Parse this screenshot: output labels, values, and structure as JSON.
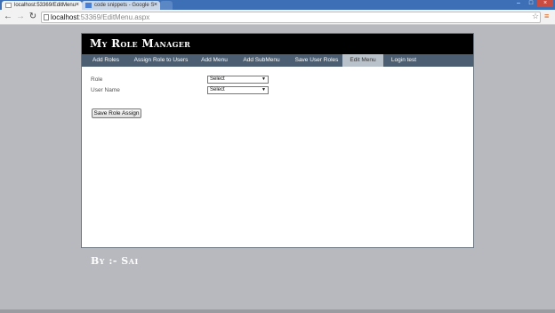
{
  "browser": {
    "tabs": [
      {
        "title": "localhost:53369/EditMenu",
        "active": true
      },
      {
        "title": "code snippets - Google S",
        "active": false
      }
    ],
    "url_host": "localhost",
    "url_path": ":53369/EditMenu.aspx",
    "close_glyph": "×",
    "window_controls": {
      "minimize": "–",
      "maximize": "□",
      "close": "×"
    }
  },
  "app": {
    "title": "My Role Manager"
  },
  "menu": [
    {
      "label": "Add Roles"
    },
    {
      "label": "Assign Role to Users"
    },
    {
      "label": "Add Menu"
    },
    {
      "label": "Add SubMenu"
    },
    {
      "label": "Save User Roles"
    },
    {
      "label": "Edit Menu",
      "selected": true
    },
    {
      "label": "Login test"
    }
  ],
  "form": {
    "role_label": "Role",
    "role_value": "Select",
    "username_label": "User Name",
    "username_value": "Select",
    "save_button": "Save Role Assign"
  },
  "signature": "By :- Sai",
  "colors": {
    "page_bg": "#b7b9bf",
    "header_bg": "#000000",
    "menubar_bg": "#4b5e72",
    "selected_menu_bg": "#b9c2cb"
  }
}
